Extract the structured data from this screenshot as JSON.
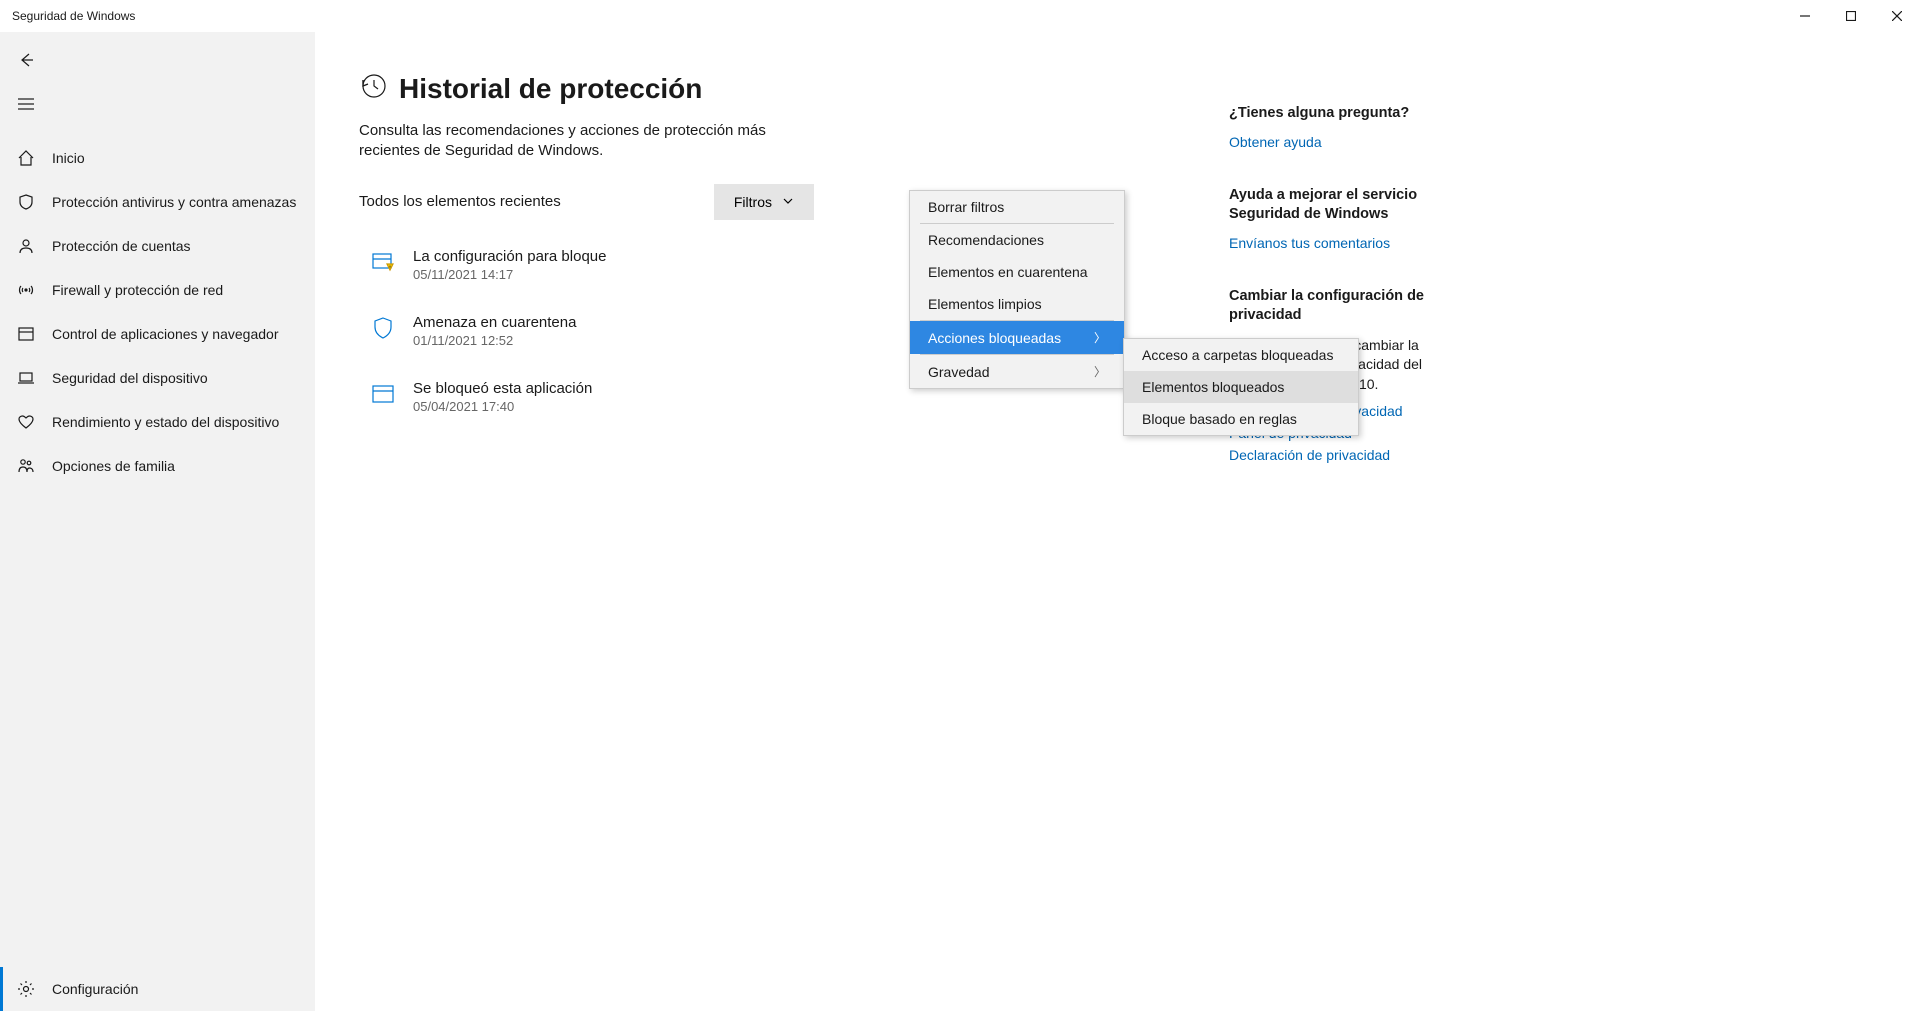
{
  "window": {
    "title": "Seguridad de Windows"
  },
  "sidebar": {
    "items": [
      {
        "label": "Inicio"
      },
      {
        "label": "Protección antivirus y contra amenazas"
      },
      {
        "label": "Protección de cuentas"
      },
      {
        "label": "Firewall y protección de red"
      },
      {
        "label": "Control de aplicaciones y navegador"
      },
      {
        "label": "Seguridad del dispositivo"
      },
      {
        "label": "Rendimiento y estado del dispositivo"
      },
      {
        "label": "Opciones de familia"
      }
    ],
    "settings": "Configuración"
  },
  "main": {
    "heading": "Historial de protección",
    "subtitle": "Consulta las recomendaciones y acciones de protección más recientes de Seguridad de Windows.",
    "filter_label": "Todos los elementos recientes",
    "filter_button": "Filtros",
    "history": [
      {
        "title": "La configuración para bloque",
        "date": "05/11/2021 14:17"
      },
      {
        "title": "Amenaza en cuarentena",
        "date": "01/11/2021 12:52"
      },
      {
        "title": "Se bloqueó esta aplicación",
        "date": "05/04/2021 17:40"
      }
    ]
  },
  "filter_menu": {
    "clear": "Borrar filtros",
    "items": [
      "Recomendaciones",
      "Elementos en cuarentena",
      "Elementos limpios",
      "Acciones bloqueadas",
      "Gravedad"
    ]
  },
  "submenu": {
    "items": [
      "Acceso a carpetas bloqueadas",
      "Elementos bloqueados",
      "Bloque basado en reglas"
    ]
  },
  "right": {
    "q_title": "¿Tienes alguna pregunta?",
    "q_link": "Obtener ayuda",
    "help_title": "Ayuda a mejorar el servicio Seguridad de Windows",
    "help_link": "Envíanos tus comentarios",
    "priv_title": "Cambiar la configuración de privacidad",
    "priv_text": "Permite visualizar y cambiar la configuración de privacidad del dispositivo Windows 10.",
    "priv_links": [
      "Configuración de privacidad",
      "Panel de privacidad",
      "Declaración de privacidad"
    ]
  }
}
